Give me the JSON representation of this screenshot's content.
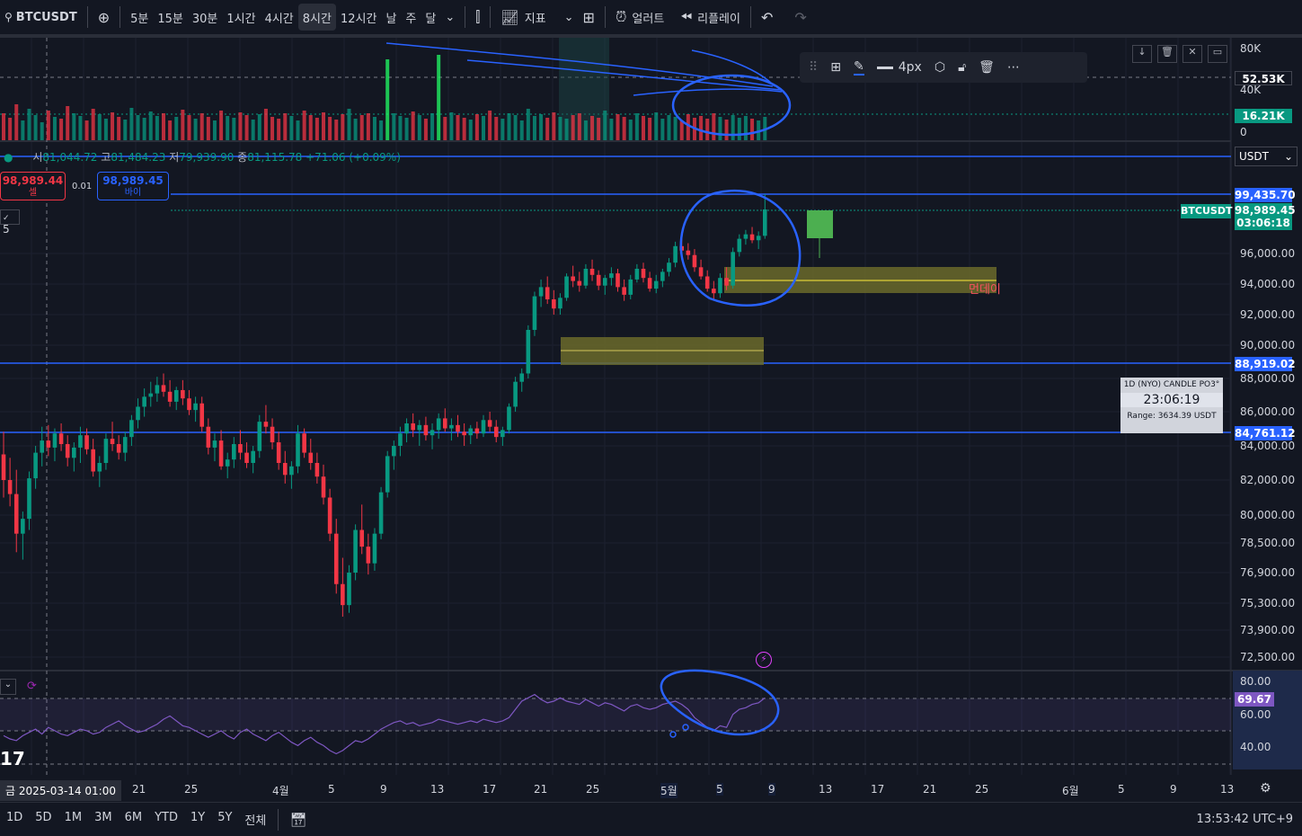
{
  "toolbar": {
    "symbol": "BTCUSDT",
    "intervals": [
      "5분",
      "15분",
      "30분",
      "1시간",
      "4시간",
      "8시간",
      "12시간",
      "날",
      "주",
      "달"
    ],
    "active_interval": "8시간",
    "indicators_label": "지표",
    "alert_label": "얼러트",
    "replay_label": "리플레이"
  },
  "drawing_toolbar": {
    "width_label": "4px"
  },
  "legend": {
    "open_label": "시",
    "open": "81,044.72",
    "high_label": "고",
    "high": "81,484.23",
    "low_label": "저",
    "low": "79,939.90",
    "close_label": "종",
    "close": "81,115.78",
    "change": "+71.06 (+0.09%)"
  },
  "trade": {
    "sell_price": "98,989.44",
    "sell_label": "셀",
    "spread": "0.01",
    "buy_price": "98,989.45",
    "buy_label": "바이",
    "qty": "5"
  },
  "price_axis": {
    "currency": "USDT",
    "ticks": [
      "96,000.00",
      "94,000.00",
      "92,000.00",
      "90,000.00",
      "88,000.00",
      "86,000.00",
      "84,000.00",
      "82,000.00",
      "80,000.00",
      "78,500.00",
      "76,900.00",
      "75,300.00",
      "73,900.00",
      "72,500.00"
    ],
    "labels": {
      "high_line": "99,435.70",
      "symbol_tag": "BTCUSDT",
      "last_price": "98,989.45",
      "countdown": "03:06:18",
      "level_1": "88,919.02",
      "level_2": "84,761.12"
    }
  },
  "volume_axis": {
    "ticks": [
      "80K",
      "40K",
      "0"
    ],
    "label_top": "52.53K",
    "label_current": "16.21K"
  },
  "rsi_axis": {
    "ticks": [
      "80.00",
      "60.00",
      "40.00"
    ],
    "current": "69.67"
  },
  "annotations": {
    "monday": "먼데이"
  },
  "candle_timer": {
    "title": "1D (NYO) CANDLE PO3°",
    "countdown": "23:06:19",
    "range": "Range: 3634.39 USDT"
  },
  "time_axis": {
    "cursor_date": "금 2025-03-14   01:00",
    "labels": [
      "21",
      "25",
      "4월",
      "5",
      "9",
      "13",
      "17",
      "21",
      "25",
      "5월",
      "5",
      "9",
      "13",
      "17",
      "21",
      "25",
      "6월",
      "5",
      "9",
      "13"
    ]
  },
  "bottom": {
    "ranges": [
      "1D",
      "5D",
      "1M",
      "3M",
      "6M",
      "YTD",
      "1Y",
      "5Y",
      "전체"
    ],
    "clock": "13:53:42 UTC+9"
  },
  "colors": {
    "bg": "#131722",
    "up": "#089981",
    "down": "#f23645",
    "line_blue": "#2962ff",
    "zone": "#6b6a2a",
    "rsi": "#7e57c2"
  },
  "chart_data": {
    "type": "candlestick",
    "ylim": [
      71500,
      100500
    ],
    "series": [
      {
        "candles": [
          [
            83500,
            84800,
            81000,
            82000
          ],
          [
            82000,
            83300,
            80500,
            81200
          ],
          [
            81200,
            82600,
            78000,
            79000
          ],
          [
            79000,
            80200,
            77600,
            79800
          ],
          [
            79800,
            82500,
            79200,
            82100
          ],
          [
            82100,
            84000,
            81500,
            83600
          ],
          [
            83600,
            85100,
            82800,
            84300
          ],
          [
            84300,
            85200,
            83400,
            83900
          ],
          [
            83900,
            85000,
            83100,
            84700
          ],
          [
            84700,
            85300,
            83700,
            84100
          ],
          [
            84100,
            84600,
            82800,
            83300
          ],
          [
            83300,
            84200,
            82500,
            83900
          ],
          [
            83900,
            85100,
            83000,
            84600
          ],
          [
            84600,
            85000,
            83500,
            83800
          ],
          [
            83800,
            84400,
            82200,
            82500
          ],
          [
            82500,
            83400,
            81600,
            83000
          ],
          [
            83000,
            84700,
            82600,
            84400
          ],
          [
            84400,
            85400,
            83700,
            84100
          ],
          [
            84100,
            84600,
            83200,
            83600
          ],
          [
            83600,
            84800,
            83100,
            84500
          ],
          [
            84500,
            85800,
            84000,
            85500
          ],
          [
            85500,
            86800,
            85000,
            86300
          ],
          [
            86300,
            87400,
            85700,
            86900
          ],
          [
            86900,
            87800,
            86300,
            87100
          ],
          [
            87100,
            88100,
            86600,
            87600
          ],
          [
            87600,
            88300,
            86900,
            87200
          ],
          [
            87200,
            87900,
            86300,
            86600
          ],
          [
            86600,
            87500,
            86100,
            87300
          ],
          [
            87300,
            87900,
            86400,
            86800
          ],
          [
            86800,
            87300,
            85800,
            86100
          ],
          [
            86100,
            86900,
            85400,
            86500
          ],
          [
            86500,
            86900,
            84800,
            85100
          ],
          [
            85100,
            85600,
            83500,
            83900
          ],
          [
            83900,
            84700,
            83100,
            84300
          ],
          [
            84300,
            84900,
            82600,
            82800
          ],
          [
            82800,
            83600,
            82100,
            83200
          ],
          [
            83200,
            84500,
            82700,
            84100
          ],
          [
            84100,
            84900,
            83200,
            83600
          ],
          [
            83600,
            84200,
            82700,
            83000
          ],
          [
            83000,
            84000,
            82400,
            83700
          ],
          [
            83700,
            85800,
            83300,
            85400
          ],
          [
            85400,
            86400,
            84700,
            85100
          ],
          [
            85100,
            85600,
            83800,
            84200
          ],
          [
            84200,
            84800,
            82600,
            83000
          ],
          [
            83000,
            83700,
            81800,
            82300
          ],
          [
            82300,
            83100,
            81500,
            82800
          ],
          [
            82800,
            85200,
            82400,
            84700
          ],
          [
            84700,
            85000,
            83300,
            83600
          ],
          [
            83600,
            84400,
            82600,
            83000
          ],
          [
            83000,
            83600,
            81800,
            82200
          ],
          [
            82200,
            82900,
            80600,
            81000
          ],
          [
            81000,
            81500,
            78600,
            79000
          ],
          [
            79000,
            79800,
            75800,
            76300
          ],
          [
            76300,
            77700,
            74600,
            75200
          ],
          [
            75200,
            77300,
            74800,
            76900
          ],
          [
            76900,
            79500,
            76500,
            79200
          ],
          [
            79200,
            80600,
            77900,
            78300
          ],
          [
            78300,
            79000,
            76800,
            77400
          ],
          [
            77400,
            79300,
            77000,
            79000
          ],
          [
            79000,
            81600,
            78700,
            81300
          ],
          [
            81300,
            83700,
            81000,
            83400
          ],
          [
            83400,
            84300,
            82600,
            84000
          ],
          [
            84000,
            85100,
            83400,
            84700
          ],
          [
            84700,
            85600,
            84200,
            85300
          ],
          [
            85300,
            85900,
            84500,
            84900
          ],
          [
            84900,
            85500,
            84000,
            85200
          ],
          [
            85200,
            85700,
            84300,
            84600
          ],
          [
            84600,
            85300,
            83800,
            84900
          ],
          [
            84900,
            85900,
            84400,
            85600
          ],
          [
            85600,
            86200,
            84800,
            85000
          ],
          [
            85000,
            85600,
            84300,
            85200
          ],
          [
            85200,
            85800,
            84500,
            84800
          ],
          [
            84800,
            85300,
            84000,
            84600
          ],
          [
            84600,
            85200,
            84100,
            85000
          ],
          [
            85000,
            85400,
            84400,
            84700
          ],
          [
            84700,
            85800,
            84500,
            85500
          ],
          [
            85500,
            86000,
            84800,
            85100
          ],
          [
            85100,
            85500,
            84200,
            84500
          ],
          [
            84500,
            85100,
            84000,
            84900
          ],
          [
            84900,
            86500,
            84700,
            86300
          ],
          [
            86300,
            88100,
            86000,
            87800
          ],
          [
            87800,
            88600,
            87200,
            88300
          ],
          [
            88300,
            91300,
            88000,
            91000
          ],
          [
            91000,
            93500,
            90600,
            93200
          ],
          [
            93200,
            94300,
            92500,
            93800
          ],
          [
            93800,
            94500,
            92700,
            93000
          ],
          [
            93000,
            93600,
            92000,
            92400
          ],
          [
            92400,
            93400,
            92000,
            93100
          ],
          [
            93100,
            94700,
            92900,
            94500
          ],
          [
            94500,
            95200,
            93800,
            94200
          ],
          [
            94200,
            94800,
            93500,
            93900
          ],
          [
            93900,
            95300,
            93700,
            95000
          ],
          [
            95000,
            95600,
            94200,
            94600
          ],
          [
            94600,
            94900,
            93600,
            93900
          ],
          [
            93900,
            94600,
            93300,
            94400
          ],
          [
            94400,
            95100,
            93900,
            94700
          ],
          [
            94700,
            95000,
            93500,
            93800
          ],
          [
            93800,
            94300,
            92900,
            93300
          ],
          [
            93300,
            94600,
            93000,
            94300
          ],
          [
            94300,
            95300,
            94100,
            95000
          ],
          [
            95000,
            95400,
            94100,
            94400
          ],
          [
            94400,
            94800,
            93500,
            93700
          ],
          [
            93700,
            94600,
            93400,
            94200
          ],
          [
            94200,
            95000,
            93800,
            94800
          ],
          [
            94800,
            95700,
            94500,
            95400
          ],
          [
            95400,
            96800,
            95100,
            96500
          ],
          [
            96500,
            97300,
            95800,
            96200
          ],
          [
            96200,
            96700,
            95600,
            95900
          ],
          [
            95900,
            96300,
            94800,
            95100
          ],
          [
            95100,
            95600,
            94300,
            94500
          ],
          [
            94500,
            94900,
            93500,
            93700
          ],
          [
            93700,
            94200,
            93000,
            93400
          ],
          [
            93400,
            94700,
            93100,
            94400
          ],
          [
            94400,
            95100,
            93600,
            93900
          ],
          [
            93900,
            96400,
            93700,
            96100
          ],
          [
            96100,
            97300,
            95800,
            97000
          ],
          [
            97000,
            97600,
            96600,
            97300
          ],
          [
            97300,
            97800,
            96700,
            96900
          ],
          [
            96900,
            97500,
            96300,
            97200
          ],
          [
            97200,
            99436,
            97000,
            98989
          ]
        ]
      }
    ],
    "rsi": [
      47,
      45,
      44,
      47,
      49,
      51,
      48,
      52,
      50,
      48,
      47,
      49,
      51,
      50,
      48,
      49,
      52,
      54,
      56,
      53,
      51,
      49,
      50,
      52,
      54,
      57,
      59,
      56,
      53,
      52,
      50,
      48,
      46,
      48,
      50,
      47,
      45,
      49,
      51,
      48,
      46,
      44,
      47,
      49,
      46,
      43,
      41,
      44,
      46,
      43,
      41,
      38,
      36,
      38,
      41,
      44,
      43,
      45,
      48,
      51,
      53,
      55,
      56,
      54,
      55,
      53,
      54,
      55,
      57,
      56,
      55,
      54,
      55,
      56,
      55,
      57,
      56,
      55,
      56,
      58,
      63,
      68,
      70,
      72,
      69,
      67,
      68,
      70,
      68,
      67,
      66,
      69,
      67,
      65,
      67,
      66,
      64,
      62,
      65,
      66,
      64,
      63,
      64,
      66,
      67,
      68,
      66,
      63,
      58,
      55,
      52,
      50,
      53,
      52,
      60,
      63,
      64,
      66,
      67,
      70
    ],
    "volume": [
      30,
      25,
      40,
      22,
      35,
      28,
      20,
      33,
      26,
      24,
      38,
      30,
      27,
      22,
      35,
      29,
      24,
      31,
      26,
      23,
      36,
      28,
      25,
      32,
      27,
      30,
      22,
      26,
      34,
      28,
      24,
      30,
      26,
      22,
      33,
      27,
      25,
      31,
      28,
      23,
      29,
      35,
      26,
      24,
      30,
      27,
      22,
      33,
      28,
      25,
      31,
      26,
      23,
      29,
      35,
      24,
      28,
      30,
      26,
      22,
      90,
      30,
      27,
      25,
      32,
      28,
      24,
      30,
      95,
      26,
      31,
      28,
      25,
      23,
      29,
      27,
      33,
      26,
      24,
      30,
      28,
      22,
      35,
      27,
      29,
      25,
      31,
      26,
      24,
      28,
      30,
      22,
      27,
      25,
      33,
      24,
      29,
      26,
      23,
      30,
      27,
      25,
      31,
      24,
      28,
      26,
      22,
      29,
      25,
      27,
      24,
      30,
      26,
      23,
      28,
      25,
      27,
      24,
      22,
      26
    ]
  }
}
